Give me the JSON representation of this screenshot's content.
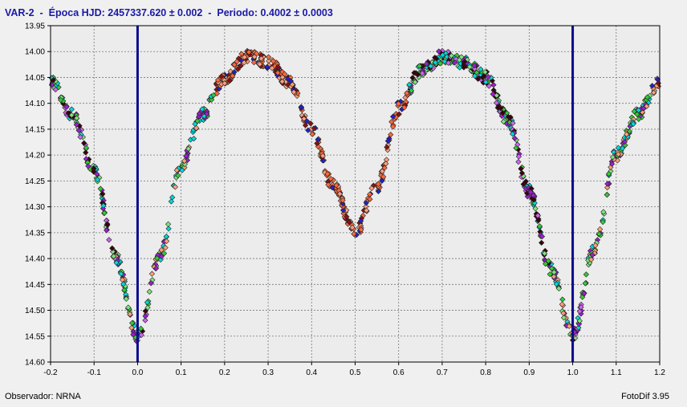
{
  "header": {
    "title": "VAR-2  -  Época HJD: 2457337.620 ± 0.002  -  Periodo: 0.4002 ± 0.0003"
  },
  "footer": {
    "observer": "Observador: NRNA",
    "software": "FotoDif 3.95"
  },
  "chart_data": {
    "type": "scatter",
    "title": "VAR-2  -  Época HJD: 2457337.620 ± 0.002  -  Periodo: 0.4002 ± 0.0003",
    "xlabel": "",
    "ylabel": "",
    "xlim": [
      -0.2,
      1.2
    ],
    "ylim": [
      13.95,
      14.6
    ],
    "y_inverted": true,
    "grid": true,
    "xticks": [
      "-0.2",
      "-0.1",
      "0.0",
      "0.1",
      "0.2",
      "0.3",
      "0.4",
      "0.5",
      "0.6",
      "0.7",
      "0.8",
      "0.9",
      "1.0",
      "1.1",
      "1.2"
    ],
    "yticks": [
      "13.95",
      "14.00",
      "14.05",
      "14.10",
      "14.15",
      "14.20",
      "14.25",
      "14.30",
      "14.35",
      "14.40",
      "14.45",
      "14.50",
      "14.55",
      "14.60"
    ],
    "vertical_lines": [
      0.0,
      1.0
    ],
    "colors": {
      "plot_background": "#ececec",
      "vertical_lines": "#0a0a8c",
      "title": "#1a1aa6",
      "series": [
        "#8b1010",
        "#2222cc",
        "#ff6a3d",
        "#ffa07a",
        "#9a1fd0",
        "#33cc33",
        "#7fe37f",
        "#00d8d8",
        "#3a0010",
        "#cc66ee"
      ]
    },
    "light_curve_samples": {
      "x": [
        -0.2,
        -0.15,
        -0.1,
        -0.05,
        0.0,
        0.05,
        0.1,
        0.15,
        0.2,
        0.25,
        0.3,
        0.35,
        0.4,
        0.45,
        0.5,
        0.55,
        0.6,
        0.65,
        0.7,
        0.75,
        0.8,
        0.85,
        0.9,
        0.95,
        1.0,
        1.05,
        1.1,
        1.15,
        1.2
      ],
      "y": [
        14.06,
        14.12,
        14.23,
        14.4,
        14.55,
        14.4,
        14.22,
        14.12,
        14.05,
        14.01,
        14.02,
        14.06,
        14.15,
        14.26,
        14.35,
        14.26,
        14.11,
        14.04,
        14.01,
        14.02,
        14.05,
        14.13,
        14.27,
        14.42,
        14.55,
        14.38,
        14.2,
        14.12,
        14.06
      ]
    }
  }
}
